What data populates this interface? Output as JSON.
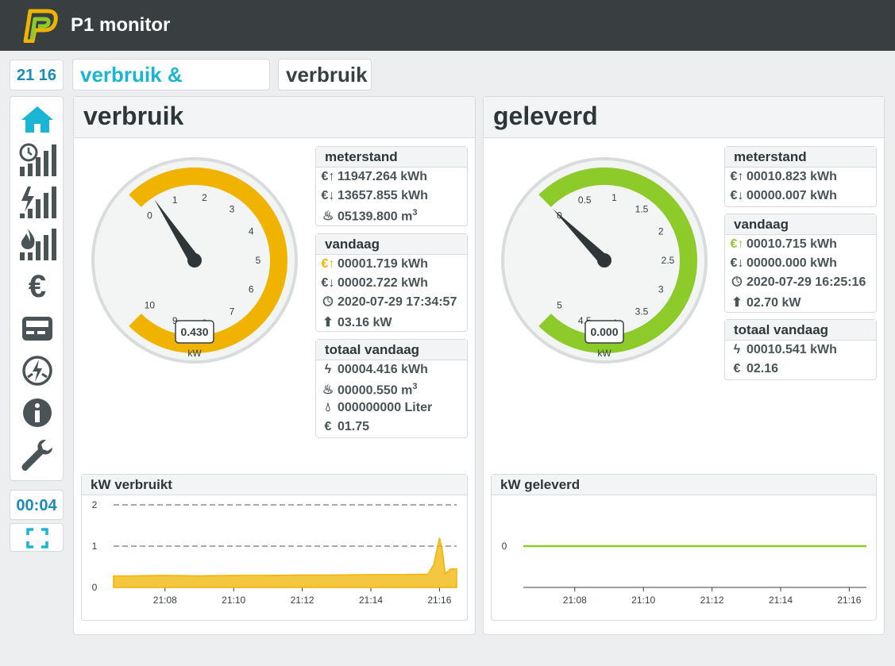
{
  "app": {
    "title": "P1 monitor"
  },
  "clock": "21 16",
  "timer": "00:04",
  "tabs": [
    {
      "label": "verbruik & levering"
    },
    {
      "label": "verbruik"
    }
  ],
  "sidebar_icons": [
    "home-icon",
    "history-icon",
    "power-history-icon",
    "gas-history-icon",
    "euro-icon",
    "meter-icon",
    "phases-icon",
    "info-icon",
    "settings-icon"
  ],
  "verbruik": {
    "title": "verbruik",
    "gauge": {
      "value": "0.430",
      "unit": "kW",
      "ticks": [
        "0",
        "1",
        "2",
        "3",
        "4",
        "5",
        "6",
        "7",
        "8",
        "9",
        "10"
      ],
      "level": 0.043,
      "color": "#f0b400"
    },
    "meterstand": {
      "title": "meterstand",
      "rows": [
        "11947.264 kWh",
        "13657.855 kWh",
        "05139.800 m"
      ],
      "sup": "3"
    },
    "vandaag": {
      "title": "vandaag",
      "rows": [
        "00001.719 kWh",
        "00002.722 kWh",
        "2020-07-29 17:34:57",
        "03.16 kW"
      ]
    },
    "totaal": {
      "title": "totaal vandaag",
      "rows": [
        "00004.416 kWh",
        "00000.550 m",
        "000000000 Liter",
        "01.75"
      ],
      "sup": "3"
    },
    "chart": {
      "title": "kW verbruikt"
    }
  },
  "geleverd": {
    "title": "geleverd",
    "gauge": {
      "value": "0.000",
      "unit": "kW",
      "ticks": [
        "0",
        "0.5",
        "1",
        "1.5",
        "2",
        "2.5",
        "3",
        "3.5",
        "4",
        "4.5",
        "5"
      ],
      "level": 0.0,
      "color": "#8dcb2b"
    },
    "meterstand": {
      "title": "meterstand",
      "rows": [
        "00010.823 kWh",
        "00000.007 kWh"
      ]
    },
    "vandaag": {
      "title": "vandaag",
      "rows": [
        "00010.715 kWh",
        "00000.000 kWh",
        "2020-07-29 16:25:16",
        "02.70 kW"
      ]
    },
    "totaal": {
      "title": "totaal vandaag",
      "rows": [
        "00010.541 kWh",
        "02.16"
      ]
    },
    "chart": {
      "title": "kW geleverd"
    }
  },
  "chart_data": [
    {
      "type": "area",
      "title": "kW verbruikt",
      "x": [
        "21:06:30",
        "21:07",
        "21:08",
        "21:09",
        "21:10",
        "21:11",
        "21:12",
        "21:13",
        "21:14",
        "21:15",
        "21:15:40",
        "21:15:50",
        "21:16:00",
        "21:16:05",
        "21:16:10",
        "21:16:20",
        "21:16:30"
      ],
      "values": [
        0.28,
        0.28,
        0.29,
        0.28,
        0.29,
        0.29,
        0.3,
        0.3,
        0.31,
        0.31,
        0.32,
        0.55,
        1.2,
        0.9,
        0.33,
        0.45,
        0.45
      ],
      "x_ticks": [
        "21:08",
        "21:10",
        "21:12",
        "21:14",
        "21:16"
      ],
      "y_ticks": [
        "0",
        "1",
        "2"
      ],
      "ylim": [
        0,
        2
      ],
      "color": "#f0b400"
    },
    {
      "type": "area",
      "title": "kW geleverd",
      "x": [
        "21:06:30",
        "21:16:30"
      ],
      "values": [
        0,
        0
      ],
      "x_ticks": [
        "21:08",
        "21:10",
        "21:12",
        "21:14",
        "21:16"
      ],
      "y_ticks": [
        "0"
      ],
      "color": "#8dcb2b"
    }
  ]
}
